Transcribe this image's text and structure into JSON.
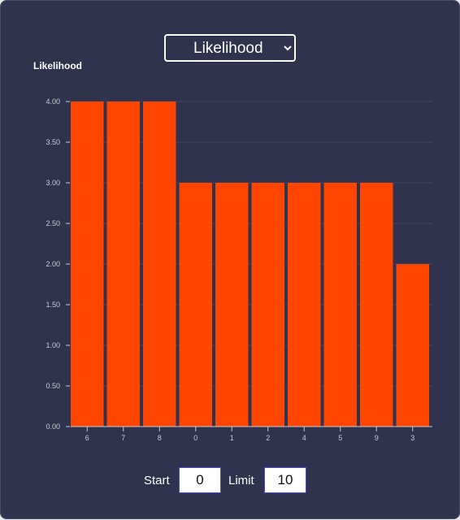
{
  "metric_select": {
    "selected": "Likelihood",
    "options": [
      "Likelihood"
    ]
  },
  "controls": {
    "start_label": "Start",
    "start_value": "0",
    "limit_label": "Limit",
    "limit_value": "10"
  },
  "colors": {
    "background": "#2f334d",
    "bar": "#ff4500",
    "text": "#ffffff",
    "axis": "#c8cad6"
  },
  "chart_data": {
    "type": "bar",
    "ylabel": "Likelihood",
    "xlabel": "",
    "categories": [
      "6",
      "7",
      "8",
      "0",
      "1",
      "2",
      "4",
      "5",
      "9",
      "3"
    ],
    "values": [
      4,
      4,
      4,
      3,
      3,
      3,
      3,
      3,
      3,
      2
    ],
    "ylim": [
      0,
      4
    ],
    "yticks": [
      "0.00",
      "0.50",
      "1.00",
      "1.50",
      "2.00",
      "2.50",
      "3.00",
      "3.50",
      "4.00"
    ],
    "grid": true,
    "legend": "none"
  }
}
